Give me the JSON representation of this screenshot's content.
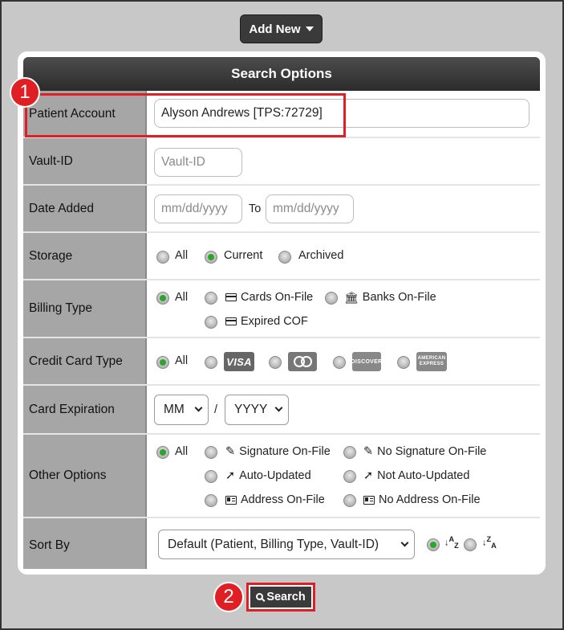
{
  "toolbar": {
    "add_new_label": "Add New"
  },
  "panel": {
    "title": "Search Options"
  },
  "patient_account": {
    "label": "Patient Account",
    "value": "Alyson Andrews [TPS:72729]"
  },
  "vault_id": {
    "label": "Vault-ID",
    "placeholder": "Vault-ID"
  },
  "date_added": {
    "label": "Date Added",
    "from_placeholder": "mm/dd/yyyy",
    "to_label": "To",
    "to_placeholder": "mm/dd/yyyy"
  },
  "storage": {
    "label": "Storage",
    "options": [
      "All",
      "Current",
      "Archived"
    ],
    "selected": "Current"
  },
  "billing_type": {
    "label": "Billing Type",
    "options": [
      "All",
      "Cards On-File",
      "Banks On-File",
      "Expired COF"
    ],
    "selected": "All"
  },
  "credit_card_type": {
    "label": "Credit Card Type",
    "options": [
      "All",
      "VISA",
      "MasterCard",
      "DISCOVER",
      "AMERICAN EXPRESS"
    ],
    "selected": "All"
  },
  "card_expiration": {
    "label": "Card Expiration",
    "month": "MM",
    "separator": "/",
    "year": "YYYY"
  },
  "other_options": {
    "label": "Other Options",
    "options": [
      "All",
      "Signature On-File",
      "No Signature On-File",
      "Auto-Updated",
      "Not Auto-Updated",
      "Address On-File",
      "No Address On-File"
    ],
    "selected": "All"
  },
  "sort_by": {
    "label": "Sort By",
    "value": "Default (Patient, Billing Type, Vault-ID)",
    "order": "ascending"
  },
  "actions": {
    "search_label": "Search"
  },
  "annotations": {
    "step1": "1",
    "step2": "2"
  },
  "colors": {
    "accent_red": "#e01f24",
    "radio_on": "#2da52d",
    "header_dark": "#3a3a3a"
  }
}
